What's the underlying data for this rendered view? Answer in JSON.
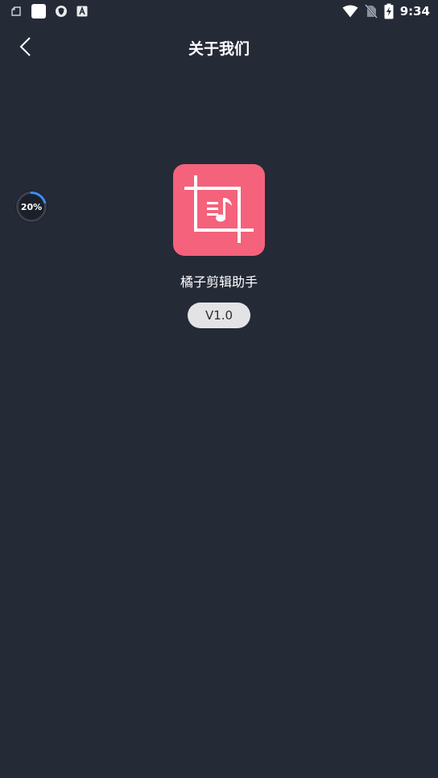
{
  "status_bar": {
    "time": "9:34",
    "left_icons": [
      "screenshot-icon",
      "square-notification-icon",
      "shield-icon",
      "a-box-icon"
    ],
    "right_icons": [
      "wifi-icon",
      "no-sim-icon",
      "battery-charging-icon"
    ]
  },
  "header": {
    "back_icon": "chevron-left-icon",
    "title": "关于我们"
  },
  "progress_badge": {
    "label": "20%",
    "value": 0.2,
    "color": "#3a8cf0"
  },
  "app": {
    "icon": "crop-music-icon",
    "icon_color": "#f4627c",
    "name": "橘子剪辑助手",
    "version": "V1.0"
  },
  "colors": {
    "background": "#252a37",
    "pill_background": "#e3e3e5"
  }
}
